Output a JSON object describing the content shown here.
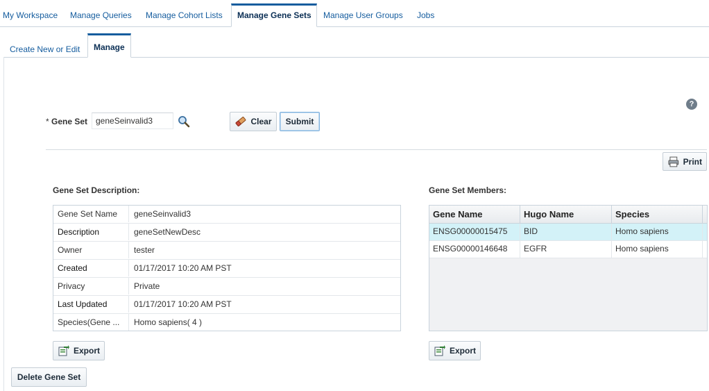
{
  "top_tabs": [
    {
      "label": "My Workspace",
      "active": false
    },
    {
      "label": "Manage Queries",
      "active": false
    },
    {
      "label": "Manage Cohort Lists",
      "active": false
    },
    {
      "label": "Manage Gene Sets",
      "active": true
    },
    {
      "label": "Manage User Groups",
      "active": false
    },
    {
      "label": "Jobs",
      "active": false
    }
  ],
  "sub_tabs": [
    {
      "label": "Create New or Edit",
      "active": false
    },
    {
      "label": "Manage",
      "active": true
    }
  ],
  "form": {
    "required_mark": "*",
    "gene_set_label": "Gene Set",
    "gene_set_value": "geneSeinvalid3",
    "clear_label": "Clear",
    "submit_label": "Submit"
  },
  "help_icon": "?",
  "print_label": "Print",
  "description": {
    "title": "Gene Set Description:",
    "rows": [
      {
        "key": "Gene Set Name",
        "value": "geneSeinvalid3"
      },
      {
        "key": "Description",
        "value": "geneSetNewDesc"
      },
      {
        "key": "Owner",
        "value": "tester"
      },
      {
        "key": "Created",
        "value": "01/17/2017 10:20 AM PST"
      },
      {
        "key": "Privacy",
        "value": "Private"
      },
      {
        "key": "Last Updated",
        "value": "01/17/2017 10:20 AM PST"
      },
      {
        "key": "Species(Gene ...",
        "value": "Homo sapiens( 4 )"
      }
    ],
    "export_label": "Export"
  },
  "members": {
    "title": "Gene Set Members:",
    "columns": [
      "Gene Name",
      "Hugo Name",
      "Species"
    ],
    "rows": [
      {
        "gene": "ENSG00000015475",
        "hugo": "BID",
        "species": "Homo sapiens",
        "selected": true
      },
      {
        "gene": "ENSG00000146648",
        "hugo": "EGFR",
        "species": "Homo sapiens",
        "selected": false
      }
    ],
    "export_label": "Export"
  },
  "delete_label": "Delete Gene Set",
  "colors": {
    "link": "#145c9e",
    "active_tab_accent": "#145c9e",
    "selected_row": "#d3f2f8"
  }
}
